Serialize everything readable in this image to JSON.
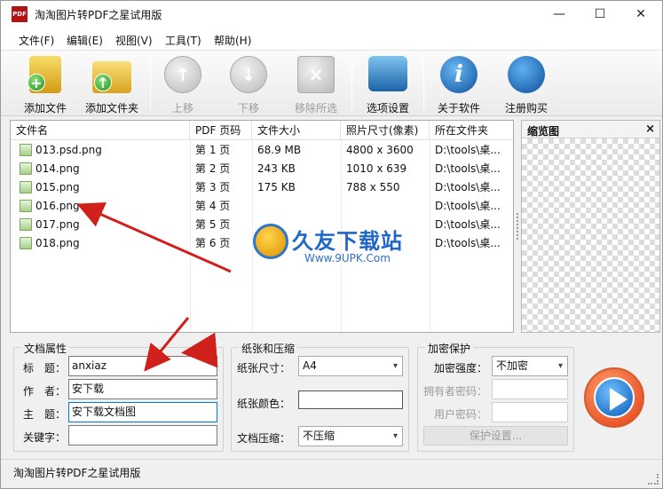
{
  "window": {
    "title": "淘淘图片转PDF之星试用版",
    "app_icon": "PDF"
  },
  "window_controls": {
    "minimize": "—",
    "maximize": "☐",
    "close": "✕"
  },
  "menu": [
    "文件(F)",
    "编辑(E)",
    "视图(V)",
    "工具(T)",
    "帮助(H)"
  ],
  "toolbar": {
    "add_file": "添加文件",
    "add_folder": "添加文件夹",
    "move_up": "上移",
    "move_down": "下移",
    "remove_selected": "移除所选",
    "options": "选项设置",
    "about": "关于软件",
    "register": "注册购买"
  },
  "file_list": {
    "columns": [
      "文件名",
      "PDF 页码",
      "文件大小",
      "照片尺寸(像素)",
      "所在文件夹"
    ],
    "rows": [
      {
        "name": "013.psd.png",
        "page": "第 1 页",
        "size": "68.9 MB",
        "dims": "4800 x 3600",
        "folder": "D:\\tools\\桌..."
      },
      {
        "name": "014.png",
        "page": "第 2 页",
        "size": "243 KB",
        "dims": "1010 x 639",
        "folder": "D:\\tools\\桌..."
      },
      {
        "name": "015.png",
        "page": "第 3 页",
        "size": "175 KB",
        "dims": "788 x 550",
        "folder": "D:\\tools\\桌..."
      },
      {
        "name": "016.png",
        "page": "第 4 页",
        "size": "",
        "dims": "",
        "folder": "D:\\tools\\桌..."
      },
      {
        "name": "017.png",
        "page": "第 5 页",
        "size": "",
        "dims": "",
        "folder": "D:\\tools\\桌..."
      },
      {
        "name": "018.png",
        "page": "第 6 页",
        "size": "",
        "dims": "",
        "folder": "D:\\tools\\桌..."
      }
    ]
  },
  "watermark": {
    "title": "久友下载站",
    "url": "Www.9UPK.Com"
  },
  "preview": {
    "title": "缩览图",
    "close": "×"
  },
  "doc_props": {
    "title": "文档属性",
    "title_label": "标　题：",
    "title_value": "anxiaz",
    "author_label": "作　者：",
    "author_value": "安下载",
    "subject_label": "主　题：",
    "subject_value": "安下载文档图",
    "keywords_label": "关键字："
  },
  "paper": {
    "title": "纸张和压缩",
    "size_label": "纸张尺寸：",
    "size_value": "A4",
    "color_label": "纸张颜色：",
    "compress_label": "文档压缩：",
    "compress_value": "不压缩"
  },
  "encrypt": {
    "title": "加密保护",
    "strength_label": "加密强度：",
    "strength_value": "不加密",
    "owner_label": "拥有者密码：",
    "user_label": "用户密码：",
    "protect_button": "保护设置..."
  },
  "status": {
    "text": "淘淘图片转PDF之星试用版"
  },
  "colors": {
    "annotation_arrow": "#d0201b",
    "accent_blue": "#0078d7"
  }
}
